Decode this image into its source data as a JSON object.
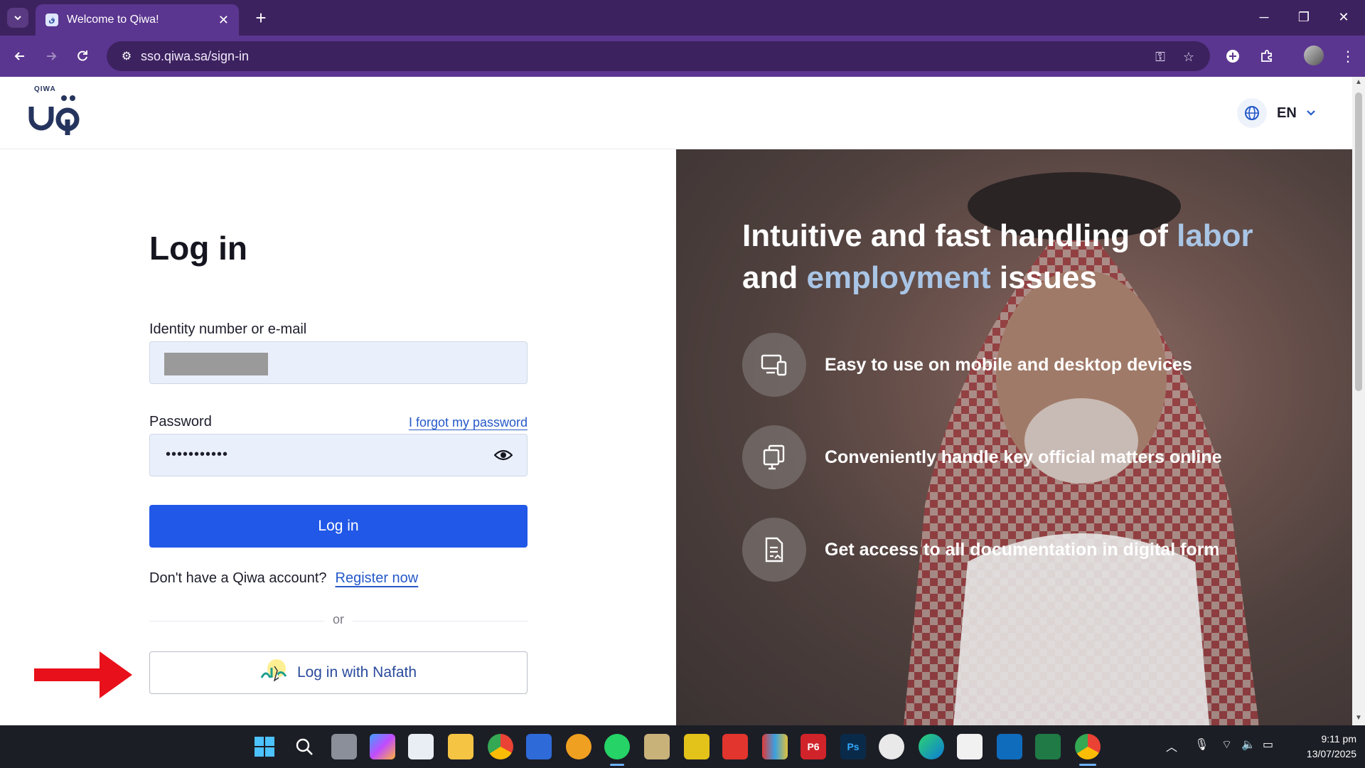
{
  "browser": {
    "tab_title": "Welcome to Qiwa!",
    "tab_favicon": "qiwa-favicon",
    "url": "sso.qiwa.sa/sign-in",
    "accent_color": "#5b3690"
  },
  "header": {
    "logo_word": "QIWA",
    "language": "EN"
  },
  "login": {
    "heading": "Log in",
    "identity_label": "Identity number or e-mail",
    "identity_value": "",
    "password_label": "Password",
    "forgot_link": "I forgot my password",
    "password_value": "•••••••••••",
    "submit_label": "Log in",
    "no_account_text": "Don't have a Qiwa account?",
    "register_link": "Register now",
    "separator": "or",
    "nafath_label": "Log in with Nafath",
    "primary_color": "#2158e8"
  },
  "promo": {
    "headline_part1": "Intuitive and fast handling of ",
    "headline_hl1": "labor",
    "headline_part2": " and ",
    "headline_hl2": "employment",
    "headline_part3": " issues",
    "features": [
      {
        "icon": "devices-icon",
        "text": "Easy to use on mobile and desktop devices"
      },
      {
        "icon": "monitor-copy-icon",
        "text": "Conveniently handle key official matters online"
      },
      {
        "icon": "document-icon",
        "text": "Get access to all documentation in digital form"
      }
    ]
  },
  "taskbar": {
    "apps": [
      "start",
      "search",
      "task-view",
      "copilot",
      "store",
      "file-explorer",
      "chrome",
      "app-a",
      "app-b",
      "whatsapp",
      "app-c",
      "app-d",
      "app-e",
      "app-f",
      "primavera-p6",
      "photoshop",
      "app-g",
      "edge",
      "app-h",
      "outlook",
      "excel",
      "chrome-active"
    ],
    "p6_label": "P6",
    "ps_label": "Ps",
    "time": "9:11 pm",
    "date": "13/07/2025"
  }
}
